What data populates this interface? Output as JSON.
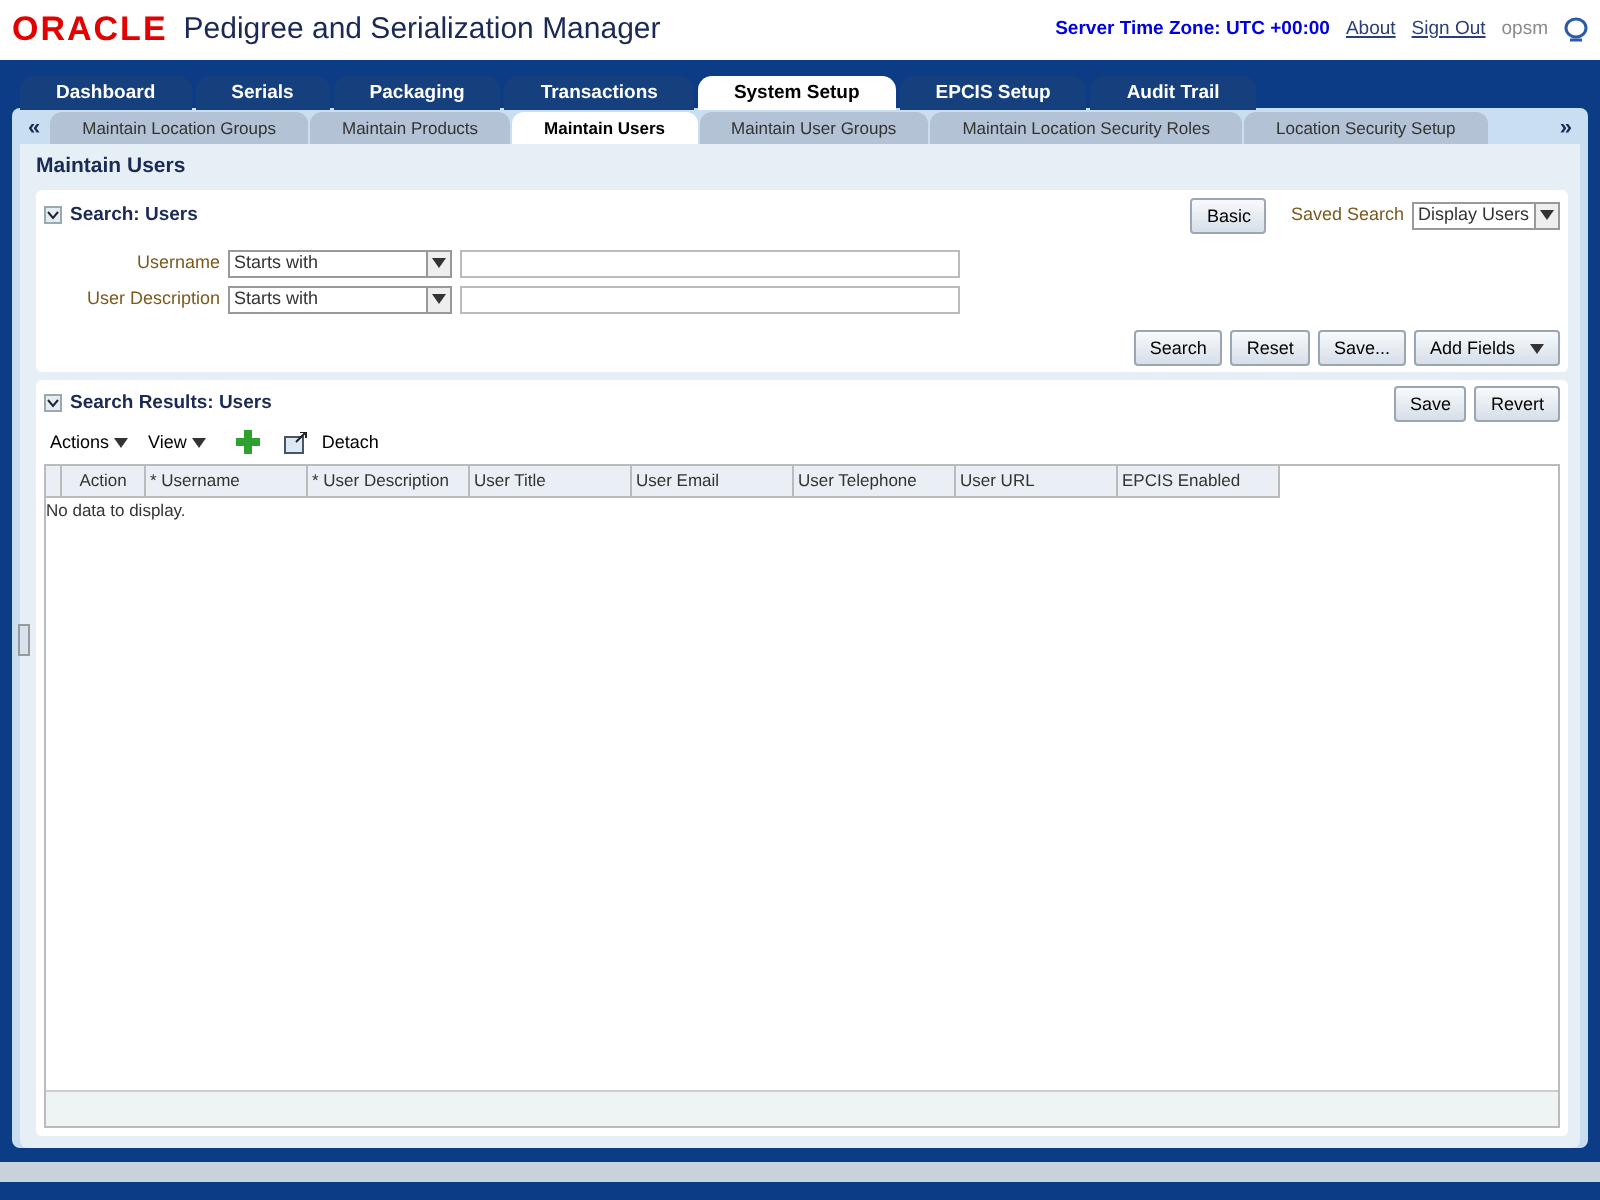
{
  "header": {
    "logo": "ORACLE",
    "app_title": "Pedigree and Serialization Manager",
    "server_time": "Server Time Zone: UTC +00:00",
    "links": [
      "About",
      "Sign Out"
    ],
    "user": "opsm"
  },
  "main_tabs": [
    {
      "label": "Dashboard",
      "selected": false
    },
    {
      "label": "Serials",
      "selected": false
    },
    {
      "label": "Packaging",
      "selected": false
    },
    {
      "label": "Transactions",
      "selected": false
    },
    {
      "label": "System Setup",
      "selected": true
    },
    {
      "label": "EPCIS Setup",
      "selected": false
    },
    {
      "label": "Audit Trail",
      "selected": false
    }
  ],
  "sub_tabs": {
    "scroll_left": "«",
    "scroll_right": "»",
    "items": [
      {
        "label": "Maintain Location Groups",
        "selected": false
      },
      {
        "label": "Maintain Products",
        "selected": false
      },
      {
        "label": "Maintain Users",
        "selected": true
      },
      {
        "label": "Maintain User Groups",
        "selected": false
      },
      {
        "label": "Maintain Location Security Roles",
        "selected": false
      },
      {
        "label": "Location Security Setup",
        "selected": false
      }
    ]
  },
  "page_title": "Maintain Users",
  "search": {
    "title": "Search: Users",
    "basic_button": "Basic",
    "saved_search_label": "Saved Search",
    "saved_search_value": "Display Users",
    "fields": [
      {
        "label": "Username",
        "operator": "Starts with"
      },
      {
        "label": "User Description",
        "operator": "Starts with"
      }
    ],
    "buttons": [
      "Search",
      "Reset",
      "Save...",
      "Add Fields"
    ]
  },
  "results": {
    "title": "Search Results: Users",
    "buttons": [
      "Save",
      "Revert"
    ],
    "menus": [
      "Actions",
      "View"
    ],
    "detach": "Detach",
    "columns": [
      "Action",
      "* Username",
      "* User Description",
      "User Title",
      "User Email",
      "User Telephone",
      "User URL",
      "EPCIS Enabled"
    ],
    "empty_message": "No data to display."
  }
}
